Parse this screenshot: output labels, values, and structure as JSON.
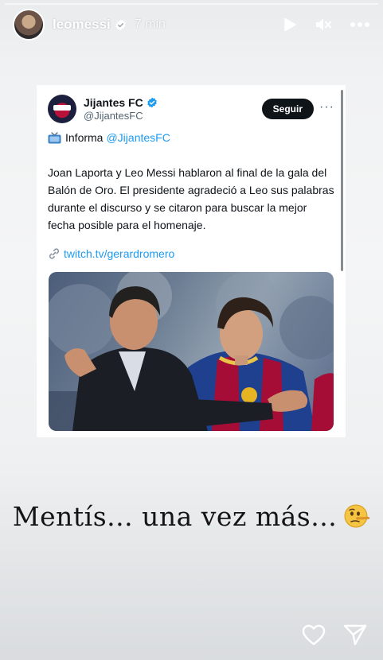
{
  "header": {
    "username": "leomessi",
    "time": "7 min"
  },
  "tweet": {
    "name": "Jijantes FC",
    "handle": "@JijantesFC",
    "follow_label": "Seguir",
    "more_label": "···",
    "intro": "Informa",
    "intro_mention": "@JijantesFC",
    "body": "Joan Laporta y Leo Messi hablaron al final de la gala del Balón de Oro. El presidente agradeció a Leo sus palabras  durante el discurso y se citaron para buscar la mejor fecha posible para el homenaje.",
    "link": "twitch.tv/gerardromero"
  },
  "caption": {
    "text": "Mentís... una vez más..."
  },
  "icons": {
    "verified": "verified-badge-icon",
    "play": "play-icon",
    "mute": "mute-icon",
    "more": "more-icon",
    "tv": "tv-icon",
    "link": "link-icon",
    "heart": "heart-icon",
    "send": "send-icon",
    "emoji": "lying-face-emoji"
  },
  "colors": {
    "twitter_blue": "#1d9bf0",
    "follow_button": "#0f1419",
    "barca_blue": "#1f3f8f",
    "barca_red": "#a50d36"
  }
}
